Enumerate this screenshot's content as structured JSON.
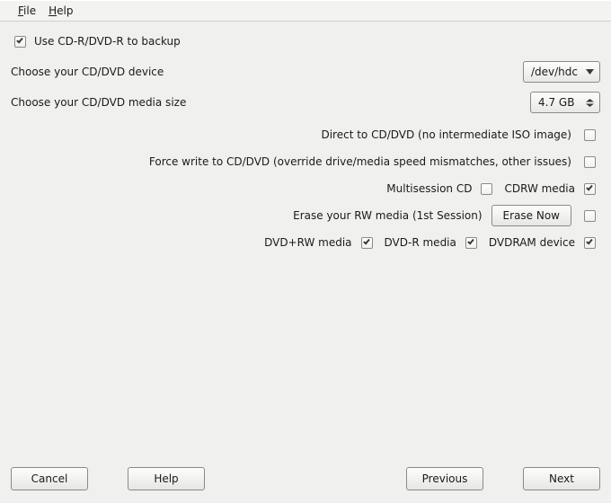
{
  "menu": {
    "file": "File",
    "help": "Help"
  },
  "useCdr": {
    "label": "Use CD-R/DVD-R to backup",
    "checked": true
  },
  "deviceRow": {
    "label": "Choose your CD/DVD device",
    "value": "/dev/hdc"
  },
  "sizeRow": {
    "label": "Choose your CD/DVD media size",
    "value": "4.7 GB"
  },
  "opts": {
    "direct": {
      "label": "Direct to CD/DVD (no intermediate ISO image)",
      "checked": false
    },
    "force": {
      "label": "Force write to CD/DVD (override drive/media speed mismatches, other issues)",
      "checked": false
    },
    "multisession": {
      "label": "Multisession CD",
      "checked": false
    },
    "cdrw": {
      "label": "CDRW media",
      "checked": true
    },
    "eraseLabel": "Erase your RW media (1st Session)",
    "eraseButton": "Erase Now",
    "eraseChecked": false,
    "dvdprw": {
      "label": "DVD+RW media",
      "checked": true
    },
    "dvdr": {
      "label": "DVD-R media",
      "checked": true
    },
    "dvdram": {
      "label": "DVDRAM device",
      "checked": true
    }
  },
  "buttons": {
    "cancel": "Cancel",
    "help": "Help",
    "previous": "Previous",
    "next": "Next"
  }
}
